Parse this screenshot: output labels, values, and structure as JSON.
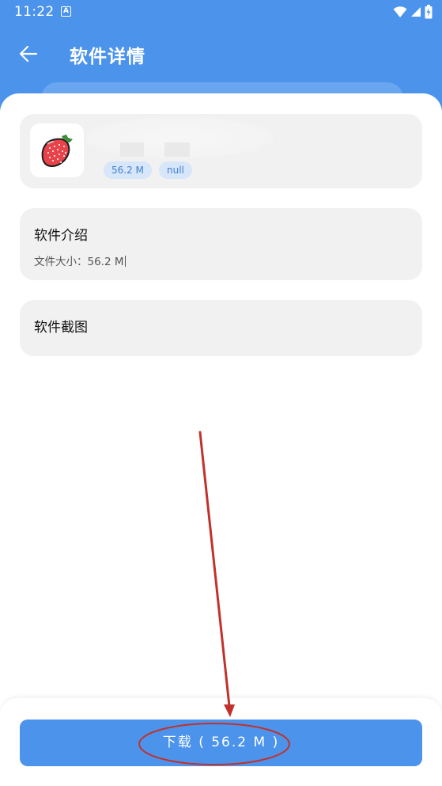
{
  "status_bar": {
    "time": "11:22",
    "a_icon": "A"
  },
  "header": {
    "title": "软件详情",
    "back_icon": "arrow-left-icon"
  },
  "app": {
    "size_tag": "56.2 M",
    "version_tag": "null"
  },
  "intro": {
    "title": "软件介绍",
    "text": "文件大小：56.2 M"
  },
  "screenshots": {
    "title": "软件截图"
  },
  "download": {
    "label": "下载 ( 56.2 M )"
  },
  "colors": {
    "primary": "#4c93ec",
    "tag_bg": "#d7e6f8",
    "tag_text": "#3e7fd6",
    "card_bg": "#f1f1f1",
    "annotation": "#c0322b"
  }
}
